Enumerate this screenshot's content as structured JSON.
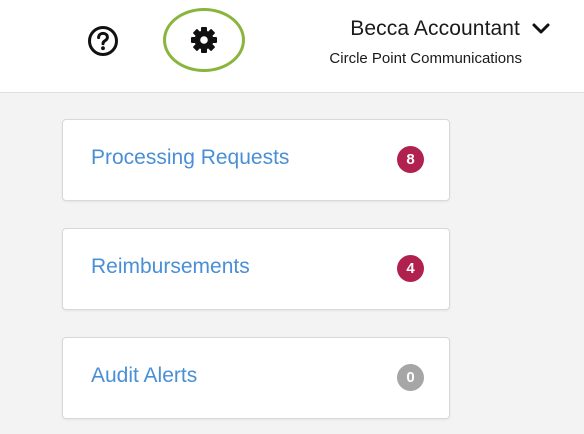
{
  "header": {
    "help_icon": "question-circle-icon",
    "settings_icon": "gear-icon",
    "settings_highlight_color": "#8ab53c",
    "user_name": "Becca Accountant",
    "user_menu_icon": "chevron-down-icon",
    "organization": "Circle Point Communications"
  },
  "cards": [
    {
      "label": "Processing Requests",
      "count": "8",
      "badge_color": "#b0214f"
    },
    {
      "label": "Reimbursements",
      "count": "4",
      "badge_color": "#b0214f"
    },
    {
      "label": "Audit Alerts",
      "count": "0",
      "badge_color": "#a6a6a6"
    }
  ],
  "colors": {
    "link": "#4a8fd6",
    "background": "#f3f3f3"
  }
}
